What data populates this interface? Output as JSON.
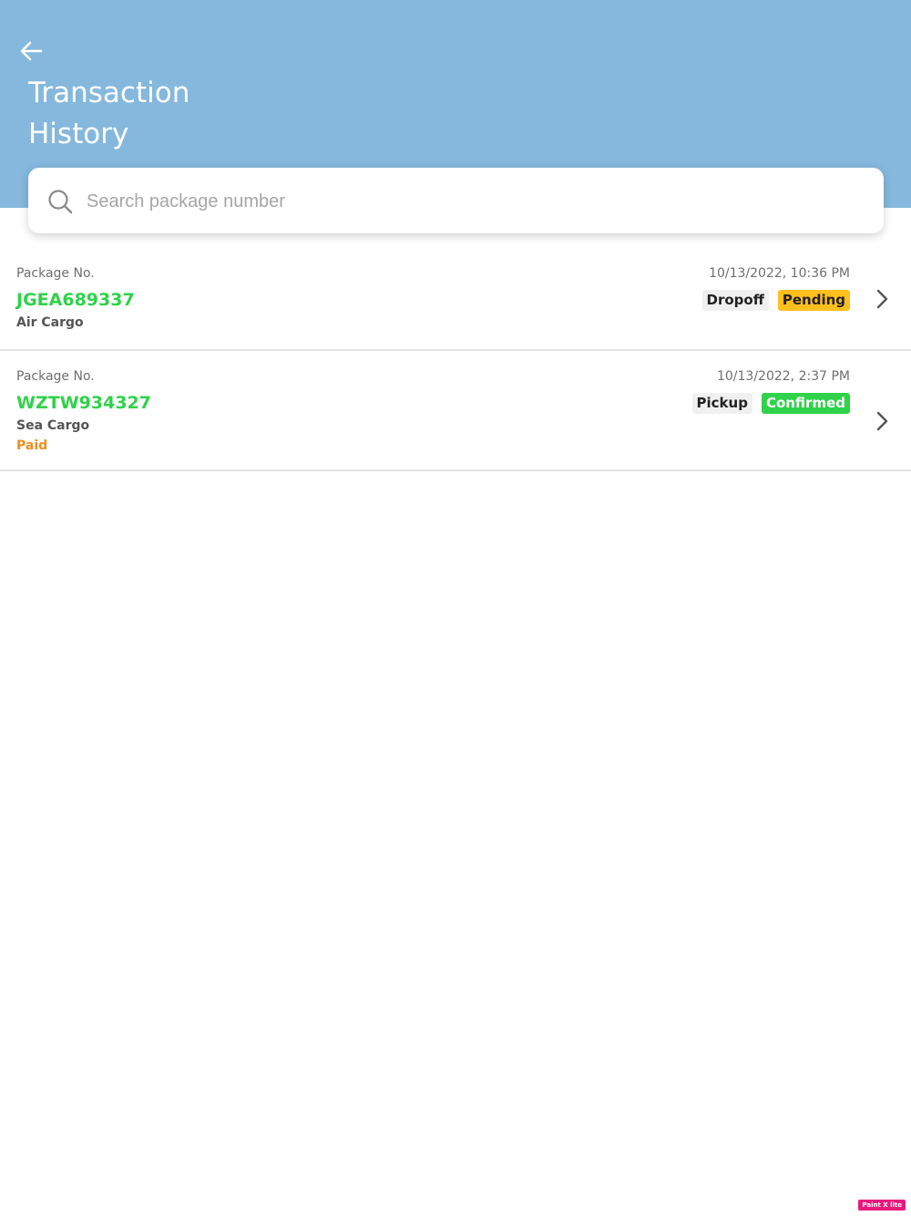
{
  "header": {
    "back_icon": "arrow-left-icon",
    "title_line1": "Transaction",
    "title_line2": "History",
    "background_color": "#85b8dc"
  },
  "search": {
    "icon": "search-icon",
    "placeholder": "Search package number",
    "value": ""
  },
  "transactions": [
    {
      "label": "Package No.",
      "package_number": "JGEA689337",
      "cargo_type": "Air Cargo",
      "payment_status": "",
      "datetime": "10/13/2022, 10:36 PM",
      "type": "Dropoff",
      "status": "Pending",
      "status_color": "#ffbf1f"
    },
    {
      "label": "Package No.",
      "package_number": "WZTW934327",
      "cargo_type": "Sea Cargo",
      "payment_status": "Paid",
      "datetime": "10/13/2022, 2:37 PM",
      "type": "Pickup",
      "status": "Confirmed",
      "status_color": "#2fd24a"
    }
  ],
  "colors": {
    "package_number": "#2fd24a",
    "paid": "#f28c1c"
  },
  "watermark": "Paint X lite"
}
